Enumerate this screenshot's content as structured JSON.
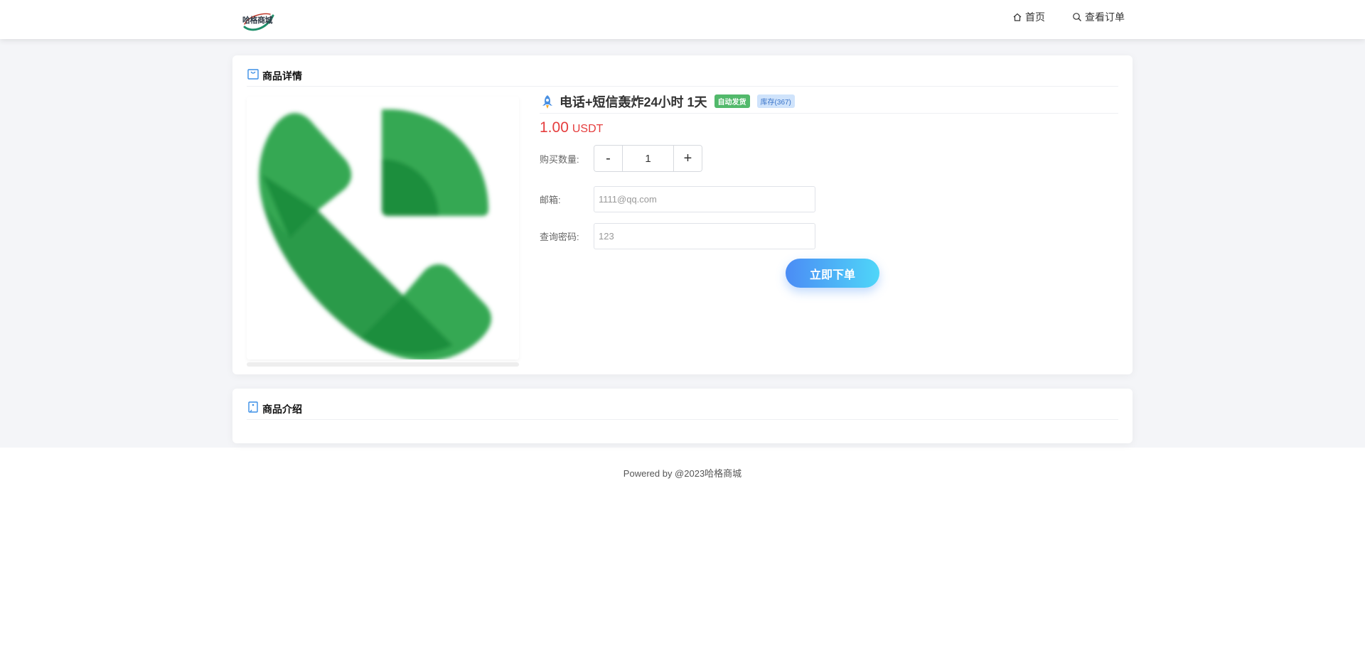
{
  "header": {
    "logo_text": "哈格商城",
    "nav": {
      "home_label": "首页",
      "orders_label": "查看订单"
    }
  },
  "detail_card": {
    "title": "商品详情",
    "product": {
      "name": "电话+短信轰炸24小时 1天",
      "badge_auto": "自动发货",
      "badge_stock": "库存(367)",
      "price": "1.00",
      "currency": "USDT",
      "image_icon": "phone-icon"
    },
    "form": {
      "quantity_label": "购买数量:",
      "quantity_minus": "-",
      "quantity_value": "1",
      "quantity_plus": "+",
      "email_label": "邮箱:",
      "email_placeholder": "1111@qq.com",
      "password_label": "查询密码:",
      "password_placeholder": "123",
      "submit_label": "立即下单"
    }
  },
  "intro_card": {
    "title": "商品介绍"
  },
  "footer": {
    "text": "Powered by @2023哈格商城"
  },
  "colors": {
    "price": "#e53d3d",
    "badge_auto": "#52b96b",
    "badge_stock_bg": "#cfe3fb",
    "button_gradient_start": "#4b8cf5",
    "button_gradient_end": "#4fd6f8",
    "phone_green": "#34a853",
    "phone_green_dark": "#1e8e3e"
  }
}
